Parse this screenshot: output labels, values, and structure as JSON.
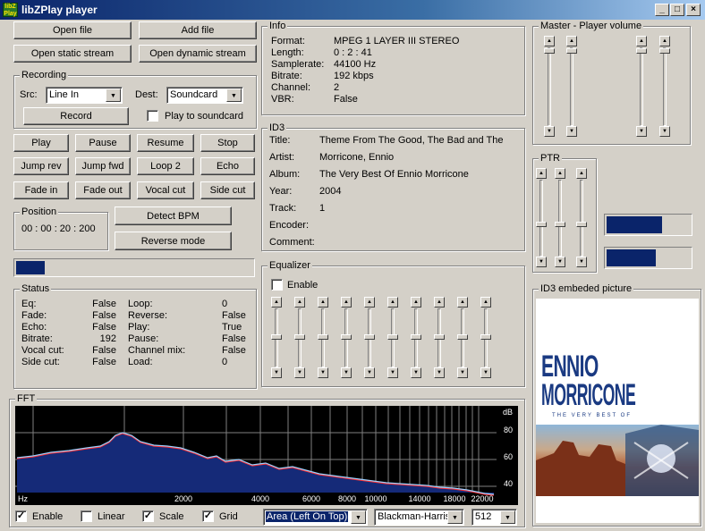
{
  "window": {
    "title": "libZPlay player",
    "icon_text": "libZ Play",
    "buttons": [
      "_",
      "□",
      "×"
    ]
  },
  "file_buttons": {
    "open_file": "Open file",
    "add_file": "Add file",
    "open_static": "Open static stream",
    "open_dynamic": "Open dynamic stream"
  },
  "recording": {
    "label": "Recording",
    "src_label": "Src:",
    "src_value": "Line In",
    "dest_label": "Dest:",
    "dest_value": "Soundcard",
    "record": "Record",
    "play_to_soundcard": "Play to soundcard"
  },
  "controls": {
    "play": "Play",
    "pause": "Pause",
    "resume": "Resume",
    "stop": "Stop",
    "jump_rev": "Jump rev",
    "jump_fwd": "Jump fwd",
    "loop2": "Loop 2",
    "echo": "Echo",
    "fade_in": "Fade in",
    "fade_out": "Fade out",
    "vocal_cut": "Vocal cut",
    "side_cut": "Side cut",
    "detect_bpm": "Detect BPM",
    "reverse_mode": "Reverse mode"
  },
  "position": {
    "label": "Position",
    "value": "00 : 00 : 20 : 200"
  },
  "progress": {
    "fraction": 0.12
  },
  "status": {
    "label": "Status",
    "left": [
      [
        "Eq:",
        "False"
      ],
      [
        "Fade:",
        "False"
      ],
      [
        "Echo:",
        "False"
      ],
      [
        "Bitrate:",
        "192"
      ],
      [
        "Vocal cut:",
        "False"
      ],
      [
        "Side cut:",
        "False"
      ]
    ],
    "right": [
      [
        "Loop:",
        "0"
      ],
      [
        "Reverse:",
        "False"
      ],
      [
        "Play:",
        "True"
      ],
      [
        "Pause:",
        "False"
      ],
      [
        "Channel mix:",
        "False"
      ],
      [
        "Load:",
        "0"
      ]
    ]
  },
  "info": {
    "label": "Info",
    "rows": [
      [
        "Format:",
        "MPEG 1 LAYER III STEREO"
      ],
      [
        "Length:",
        "0 : 2 : 41"
      ],
      [
        "Samplerate:",
        "44100 Hz"
      ],
      [
        "Bitrate:",
        "192 kbps"
      ],
      [
        "Channel:",
        "2"
      ],
      [
        "VBR:",
        "False"
      ]
    ]
  },
  "id3": {
    "label": "ID3",
    "rows": [
      [
        "Title:",
        "Theme From The Good, The Bad and The"
      ],
      [
        "Artist:",
        "Morricone, Ennio"
      ],
      [
        "Album:",
        "The Very Best Of Ennio Morricone"
      ],
      [
        "Year:",
        "2004"
      ],
      [
        "Track:",
        "1"
      ],
      [
        "Encoder:",
        ""
      ],
      [
        "Comment:",
        ""
      ]
    ]
  },
  "equalizer": {
    "label": "Equalizer",
    "enable": "Enable",
    "bands": 10
  },
  "master": {
    "label": "Master - Player volume"
  },
  "ptr": {
    "label": "PTR",
    "bar1_fraction": 0.65,
    "bar2_fraction": 0.58
  },
  "picture": {
    "label": "ID3 embeded picture",
    "line1": "ENNIO",
    "line2": "MORRICONE",
    "line3": "THE VERY BEST OF"
  },
  "fft": {
    "label": "FFT",
    "db_label": "dB",
    "hz_label": "Hz",
    "db_ticks": [
      "80",
      "60",
      "40"
    ],
    "freq_ticks": [
      "2000",
      "4000",
      "6000",
      "8000",
      "10000",
      "14000",
      "18000",
      "22000"
    ],
    "enable": "Enable",
    "linear": "Linear",
    "scale": "Scale",
    "grid": "Grid",
    "mode_value": "Area (Left On Top)",
    "window_value": "Blackman-Harris",
    "size_value": "512",
    "checks": {
      "enable": true,
      "linear": false,
      "scale": true,
      "grid": true
    }
  },
  "colors": {
    "fill": "#152a78",
    "line_left": "#ff3030",
    "line_right": "#9ad0ff",
    "grid": "#808080"
  }
}
